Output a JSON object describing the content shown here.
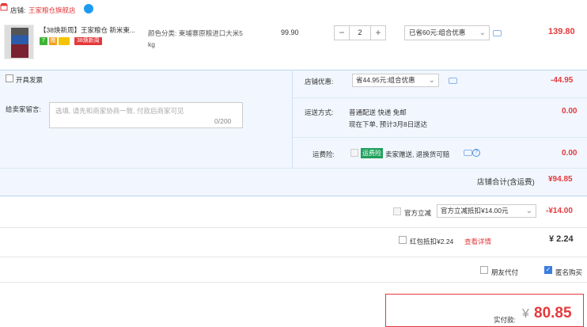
{
  "shop": {
    "label": "店铺:",
    "name": "王家粮仓旗舰店"
  },
  "item": {
    "title": "【38焕新周】王家粮仓 新米東...",
    "badges": [
      "7",
      "赠"
    ],
    "promo_tag": "38焕新周",
    "spec_line1": "颜色分类: 東埔寨原粮进口大米5",
    "spec_line2": "kg",
    "price": "99.90",
    "quantity": "2",
    "qty_minus": "−",
    "qty_plus": "+",
    "promo_select": "已省60元:组合优惠",
    "total": "139.80"
  },
  "invoice": {
    "label": "开具发票"
  },
  "shop_discount": {
    "label": "店铺优惠:",
    "select": "省44.95元:组合优惠",
    "value": "-44.95"
  },
  "message": {
    "label": "给卖家留言:",
    "placeholder_line1": "选填, 请先和商家协商一致, 付款后商家可见",
    "count": "0/200"
  },
  "delivery": {
    "label": "运送方式:",
    "line1": "普通配送 快递 免邮",
    "line2": "现在下单, 预计3月8日送达",
    "value": "0.00"
  },
  "insurance": {
    "label": "运费险:",
    "tag": "运费险",
    "text": "卖家赠送, 退换货可赔",
    "value": "0.00"
  },
  "shop_total": {
    "label": "店铺合计(含运费)",
    "value": "¥94.85"
  },
  "official_discount": {
    "label": "官方立减",
    "select": "官方立减抵扣¥14.00元",
    "value": "-¥14.00"
  },
  "red_packet": {
    "label": "红包抵扣¥2.24",
    "link": "查看详情",
    "value": "¥ 2.24"
  },
  "friend_pay": {
    "label": "朋友代付"
  },
  "anonymous": {
    "label": "匿名购买"
  },
  "payment": {
    "label": "实付款:",
    "currency": "¥",
    "amount": "80.85"
  },
  "colors": {
    "accent": "#e4393c",
    "panel_bg": "#f2f7ff",
    "link": "#3b7de0"
  }
}
